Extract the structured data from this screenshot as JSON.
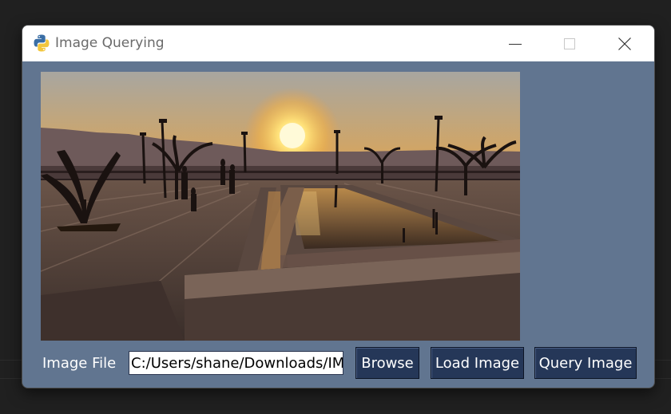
{
  "window": {
    "title": "Image Querying",
    "app_icon": "python-icon",
    "controls": {
      "minimize": "minimize-icon",
      "maximize": "maximize-icon",
      "close": "close-icon"
    }
  },
  "image_file_label": "Image File",
  "image_file_value": "C:/Users/shane/Downloads/IMG",
  "buttons": {
    "browse": "Browse",
    "load": "Load Image",
    "query": "Query Image"
  },
  "colors": {
    "window_body": "#617590",
    "button_bg": "#253758",
    "button_text": "#ffffff",
    "desktop_bg": "#202020"
  }
}
